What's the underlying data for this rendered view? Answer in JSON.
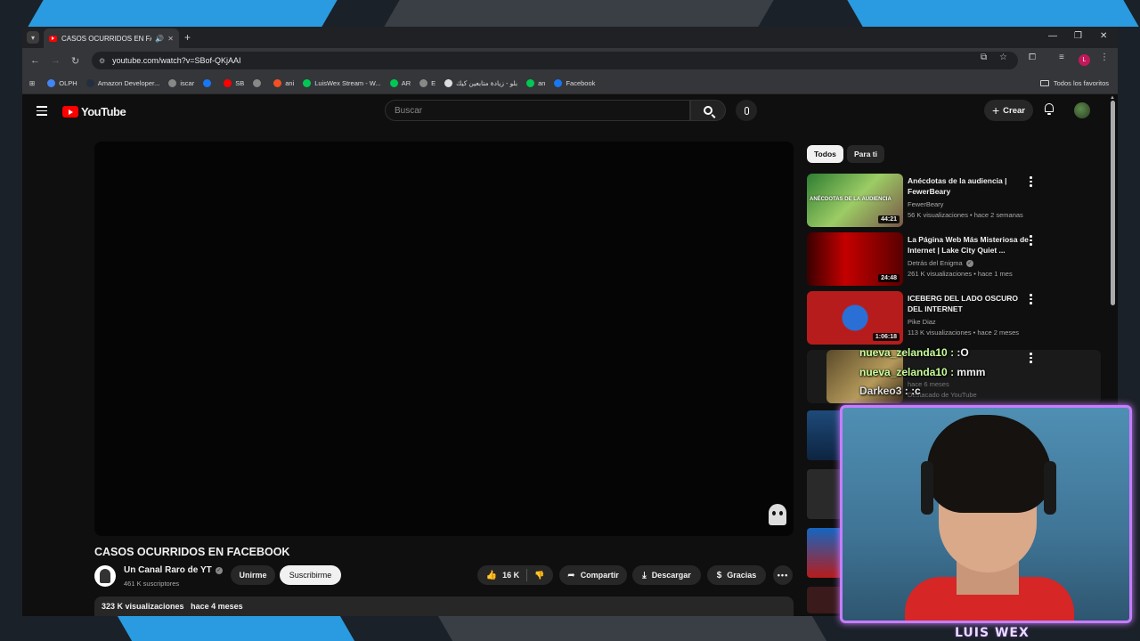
{
  "browser": {
    "tab_title": "CASOS OCURRIDOS EN FA...",
    "url": "youtube.com/watch?v=SBof-QKjAAI",
    "profile_initial": "L",
    "bookmarks": [
      {
        "label": "OLPH",
        "color": "#4285f4"
      },
      {
        "label": "Amazon Developer...",
        "color": "#232f3e"
      },
      {
        "label": "iscar",
        "color": "#888888"
      },
      {
        "label": "",
        "color": "#1877f2"
      },
      {
        "label": "SB",
        "color": "#ff0000"
      },
      {
        "label": "",
        "color": "#888888"
      },
      {
        "label": "ani",
        "color": "#f25022"
      },
      {
        "label": "LuisWex Stream - W...",
        "color": "#00c853"
      },
      {
        "label": "AR",
        "color": "#00c853"
      },
      {
        "label": "E",
        "color": "#888888"
      },
      {
        "label": "بلو - زيادة متابعين كيك",
        "color": "#dddddd"
      },
      {
        "label": "an",
        "color": "#00c853"
      },
      {
        "label": "Facebook",
        "color": "#1877f2"
      }
    ],
    "bookmarks_folder": "Todos los favoritos"
  },
  "youtube": {
    "logo_text": "YouTube",
    "search_placeholder": "Buscar",
    "create_label": "Crear",
    "video": {
      "title": "CASOS OCURRIDOS EN FACEBOOK",
      "channel": "Un Canal Raro de YT",
      "subscribers": "461 K suscriptores",
      "join_label": "Unirme",
      "subscribe_label": "Suscribirme",
      "likes": "16 K",
      "share_label": "Compartir",
      "download_label": "Descargar",
      "thanks_label": "Gracias",
      "views": "323 K visualizaciones",
      "age": "hace 4 meses"
    },
    "chips": [
      "Todos",
      "Para ti"
    ],
    "recommendations": [
      {
        "title": "Anécdotas de la audiencia | FewerBeary",
        "channel": "FewerBeary",
        "meta": "56 K visualizaciones • hace 2 semanas",
        "duration": "44:21",
        "thumb_text": "ANÉCDOTAS DE LA AUDIENCIA"
      },
      {
        "title": "La Página Web Más Misteriosa de Internet | Lake City Quiet ...",
        "channel": "Detrás del Enigma",
        "meta": "261 K visualizaciones • hace 1 mes",
        "duration": "24:48",
        "thumb_text": ""
      },
      {
        "title": "ICEBERG DEL LADO OSCURO DEL INTERNET",
        "channel": "Pike Diaz",
        "meta": "113 K visualizaciones • hace 2 meses",
        "duration": "1:06:18",
        "thumb_text": ""
      },
      {
        "title": "",
        "channel": "hace 6 meses",
        "meta": "Destacado de YouTube",
        "duration": "",
        "thumb_text": ""
      }
    ]
  },
  "overlay": {
    "chat": [
      {
        "user": "nueva_zelanda10",
        "message": ":O"
      },
      {
        "user": "nueva_zelanda10",
        "message": "mmm"
      },
      {
        "user": "Darkeo3",
        "message": ":c"
      }
    ],
    "streamer_name": "LUIS WEX",
    "frame_color": "#c77dff"
  }
}
